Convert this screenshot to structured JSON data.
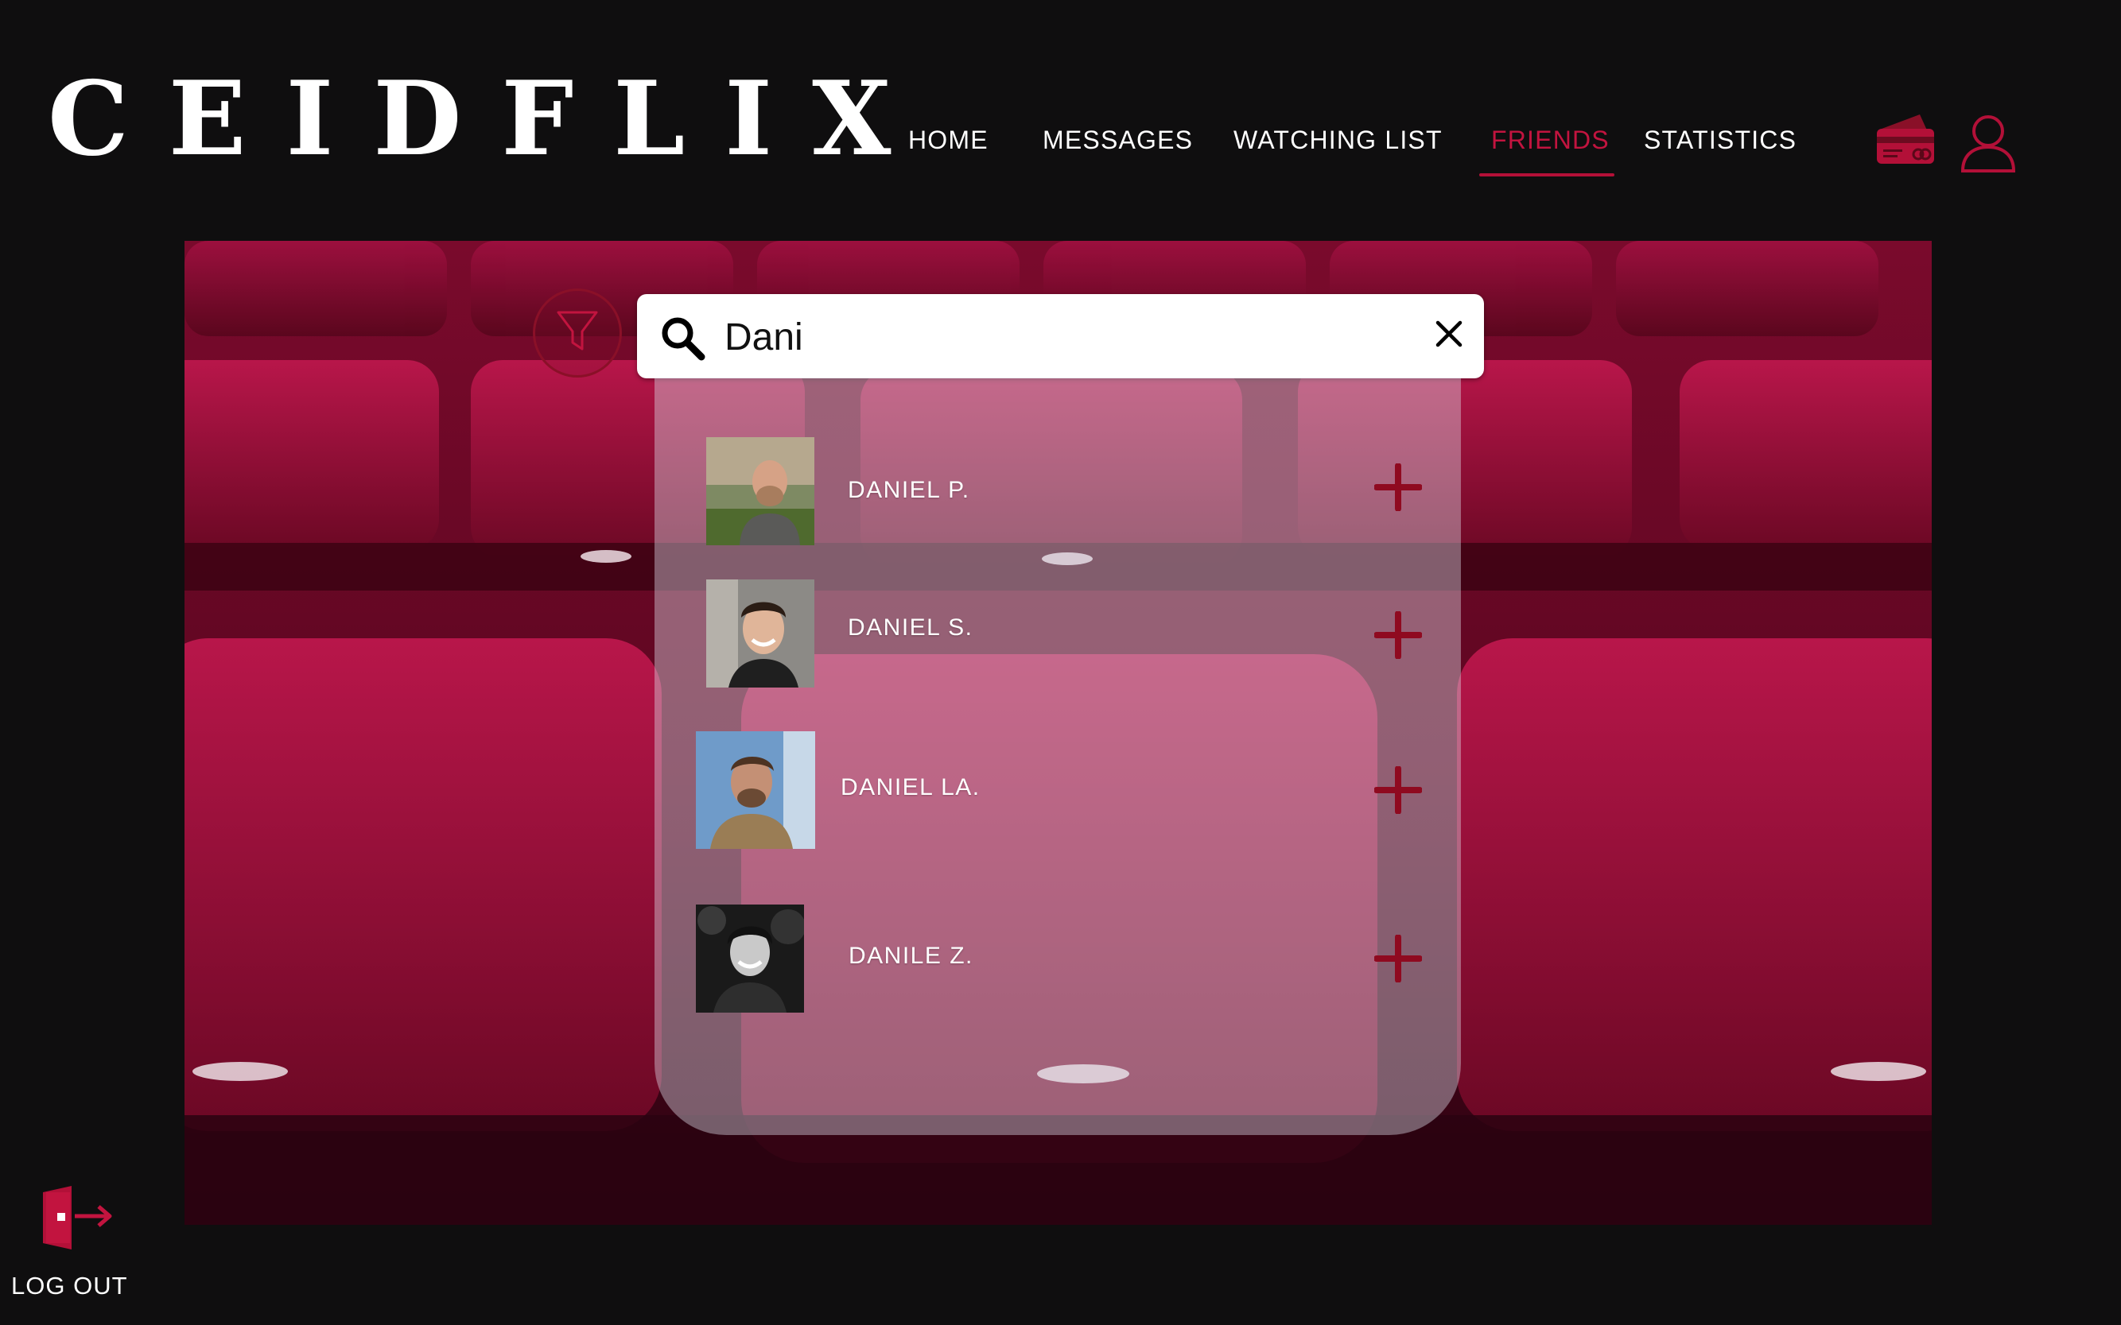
{
  "app": {
    "logo": "CEIDFLIX"
  },
  "nav": {
    "items": [
      {
        "label": "HOME"
      },
      {
        "label": "MESSAGES"
      },
      {
        "label": "WATCHING LIST"
      },
      {
        "label": "FRIENDS",
        "active": true
      },
      {
        "label": "STATISTICS"
      }
    ]
  },
  "header_icons": {
    "payment": "credit-card-icon",
    "profile": "user-icon"
  },
  "search": {
    "value": "Dani",
    "placeholder": ""
  },
  "results": [
    {
      "name": "DANIEL P.",
      "action": "plus-icon"
    },
    {
      "name": "DANIEL S.",
      "action": "plus-icon"
    },
    {
      "name": "DANIEL LA.",
      "action": "plus-icon"
    },
    {
      "name": "DANILE Z.",
      "action": "plus-icon"
    }
  ],
  "logout": {
    "label": "LOG OUT"
  },
  "colors": {
    "background": "#0f0e0f",
    "accent": "#c2143f",
    "accent_dark": "#8a1028",
    "text": "#ffffff"
  }
}
